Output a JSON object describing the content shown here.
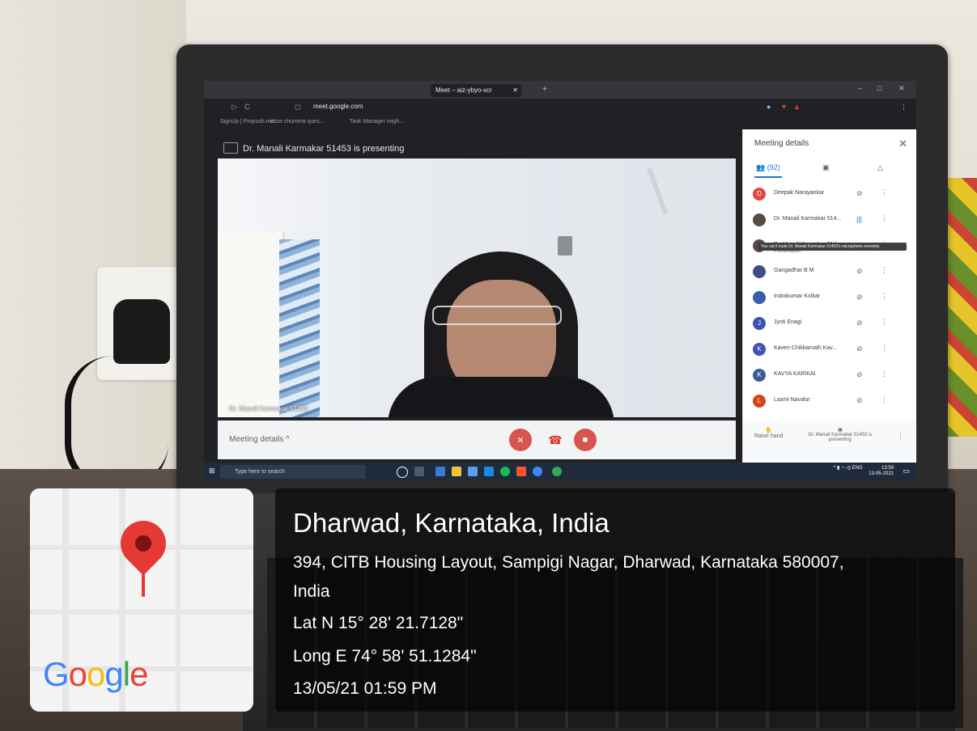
{
  "browser": {
    "tabs": [
      {
        "label": "",
        "active": false
      },
      {
        "label": "Meet – aiz-ybyo-xcr",
        "active": true
      }
    ],
    "url": "meet.google.com",
    "bookmarks": [
      "SignUp | Propush.me",
      "cbse chumma ques...",
      "Task Manager migh..."
    ]
  },
  "meet": {
    "presenting_banner": "Dr. Manali Karmakar 51453 is presenting",
    "video_name": "Dr. Manali Karmakar 51453",
    "meeting_details": "Meeting details",
    "panel": {
      "title": "Meeting details",
      "people_count": "(92)",
      "participants": [
        {
          "name": "Deepak Narayankar",
          "initial": "D",
          "color": "#e8453c"
        },
        {
          "name": "Dr. Manali Karmakar 514...",
          "initial": "",
          "color": "#5a4a45"
        },
        {
          "name": "Dr. Manali Karmakar 514...",
          "sub": "Presentation",
          "initial": "",
          "color": "#5a4a45"
        },
        {
          "name": "Gangadhar B M",
          "initial": "",
          "color": "#3c4f8a"
        },
        {
          "name": "Indrakumar Kolkar",
          "initial": "",
          "color": "#3a5cab"
        },
        {
          "name": "Jyoti Enagi",
          "initial": "J",
          "color": "#3f51b5"
        },
        {
          "name": "Kaveri Chikkamath Kav...",
          "initial": "K",
          "color": "#3f51b5"
        },
        {
          "name": "KAVYA KARIKAI",
          "initial": "K",
          "color": "#3c5a9a"
        },
        {
          "name": "Laxmi Navalur",
          "initial": "L",
          "color": "#d84315"
        }
      ],
      "tooltip": "You can't mute Dr. Manali Karmakar 51453's microphone remotely",
      "raise_hand": "Raise hand",
      "presenting_status": "Dr. Manali Karmakar 51453 is presenting"
    }
  },
  "taskbar": {
    "search_placeholder": "Type here to search",
    "language": "ENG",
    "time": "13:59",
    "date": "13-05-2021"
  },
  "geo": {
    "map_brand": "Google",
    "city": "Dharwad, Karnataka, India",
    "address_line1": "394, CITB Housing Layout, Sampigi Nagar, Dharwad, Karnataka 580007,",
    "address_line2": "India",
    "lat": "Lat N 15° 28' 21.7128\"",
    "long": "Long E 74° 58' 51.1284\"",
    "datetime": "13/05/21 01:59 PM"
  }
}
